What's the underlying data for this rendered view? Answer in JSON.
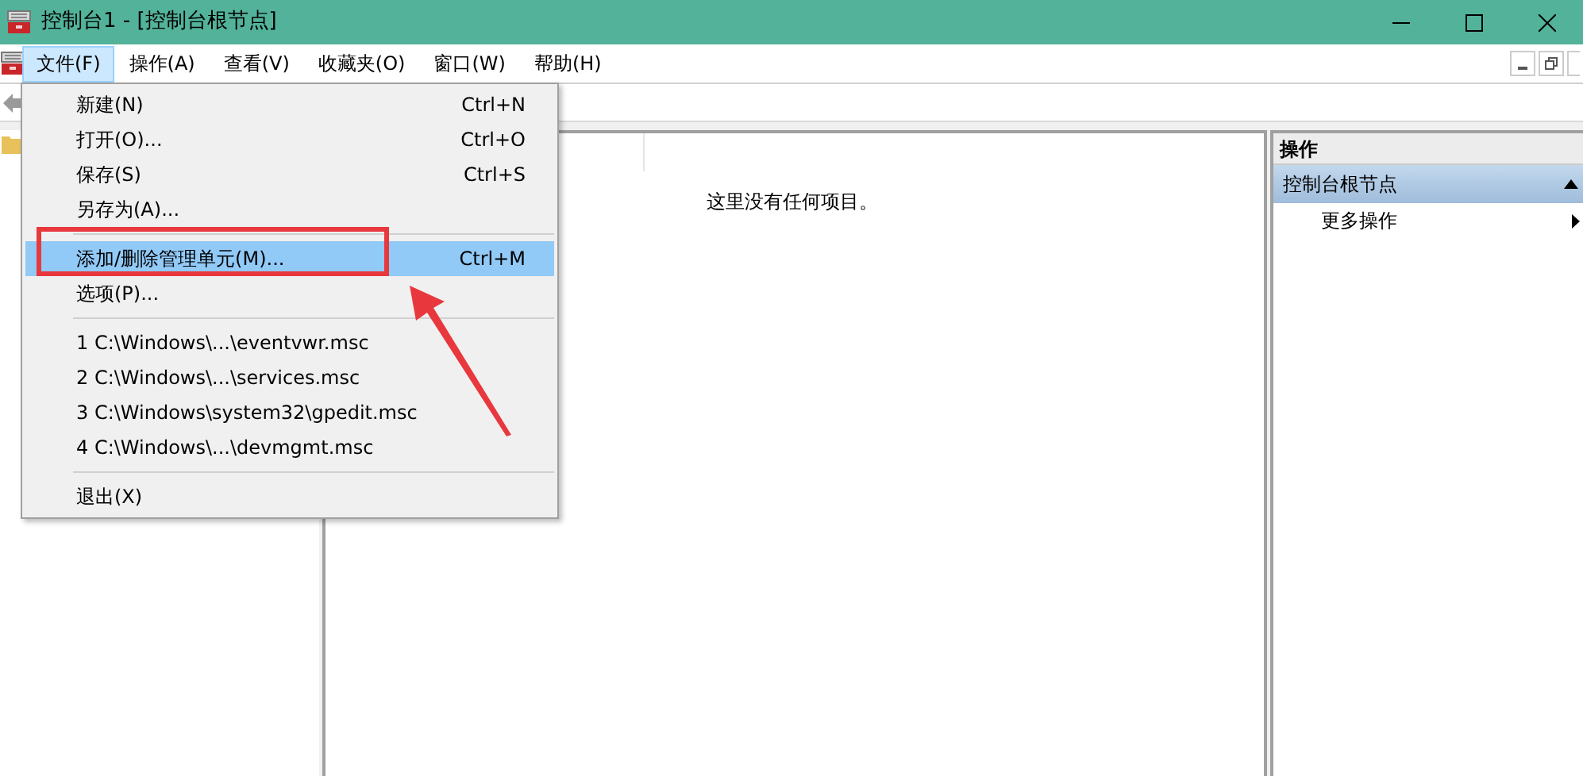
{
  "window": {
    "title": "控制台1 - [控制台根节点]"
  },
  "menu_bar": [
    {
      "label": "文件(F)",
      "selected": true
    },
    {
      "label": "操作(A)",
      "selected": false
    },
    {
      "label": "查看(V)",
      "selected": false
    },
    {
      "label": "收藏夹(O)",
      "selected": false
    },
    {
      "label": "窗口(W)",
      "selected": false
    },
    {
      "label": "帮助(H)",
      "selected": false
    }
  ],
  "file_menu": {
    "items": [
      {
        "kind": "item",
        "label": "新建(N)",
        "shortcut": "Ctrl+N",
        "selected": false
      },
      {
        "kind": "item",
        "label": "打开(O)...",
        "shortcut": "Ctrl+O",
        "selected": false
      },
      {
        "kind": "item",
        "label": "保存(S)",
        "shortcut": "Ctrl+S",
        "selected": false
      },
      {
        "kind": "item",
        "label": "另存为(A)...",
        "selected": false
      },
      {
        "kind": "separator"
      },
      {
        "kind": "item",
        "label": "添加/删除管理单元(M)...",
        "shortcut": "Ctrl+M",
        "selected": true
      },
      {
        "kind": "item",
        "label": "选项(P)...",
        "selected": false
      },
      {
        "kind": "separator"
      },
      {
        "kind": "item",
        "label": "1 C:\\Windows\\...\\eventvwr.msc",
        "selected": false
      },
      {
        "kind": "item",
        "label": "2 C:\\Windows\\...\\services.msc",
        "selected": false
      },
      {
        "kind": "item",
        "label": "3 C:\\Windows\\system32\\gpedit.msc",
        "selected": false
      },
      {
        "kind": "item",
        "label": "4 C:\\Windows\\...\\devmgmt.msc",
        "selected": false
      },
      {
        "kind": "separator"
      },
      {
        "kind": "item",
        "label": "退出(X)",
        "selected": false
      }
    ]
  },
  "content": {
    "empty_message": "这里没有任何项目。"
  },
  "actions_pane": {
    "title": "操作",
    "sections": [
      {
        "label": "控制台根节点",
        "expanded": true,
        "items": [
          {
            "label": "更多操作"
          }
        ]
      }
    ]
  }
}
